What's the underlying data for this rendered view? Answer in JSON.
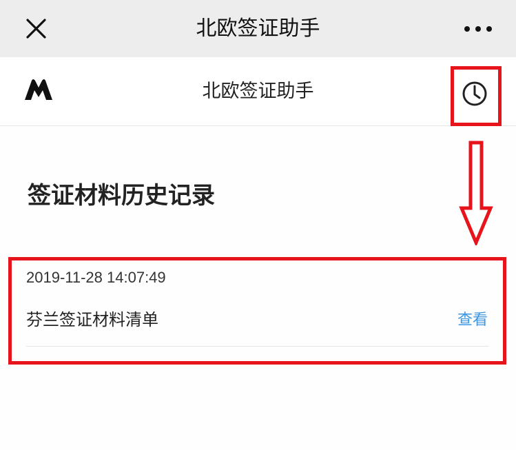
{
  "wechat_bar": {
    "title": "北欧签证助手",
    "close_icon": "close-icon",
    "more_icon": "more-horizontal-icon"
  },
  "app_header": {
    "title": "北欧签证助手",
    "logo_icon": "brand-logo-icon",
    "history_icon": "clock-icon"
  },
  "page": {
    "heading": "签证材料历史记录"
  },
  "records": [
    {
      "time": "2019-11-28 14:07:49",
      "title": "芬兰签证材料清单",
      "action_label": "查看"
    }
  ],
  "colors": {
    "annotation": "#e8141c",
    "link": "#3b97e3",
    "wechat_bar_bg": "#ededed"
  }
}
